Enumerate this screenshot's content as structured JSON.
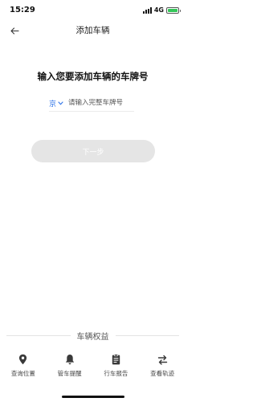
{
  "status_bar": {
    "time": "15:29",
    "network": "4G",
    "colors": {
      "battery": "#34c759"
    }
  },
  "nav": {
    "title": "添加车辆",
    "back_icon": "arrow-left-icon"
  },
  "form": {
    "heading": "输入您要添加车辆的车牌号",
    "province": "京",
    "plate_placeholder": "请输入完整车牌号",
    "plate_value": "",
    "next_label": "下一步",
    "colors": {
      "accent": "#2f74e8",
      "button_disabled": "#e5e5e5"
    }
  },
  "benefits": {
    "title": "车辆权益",
    "items": [
      {
        "label": "查询位置",
        "icon": "location-pin-icon"
      },
      {
        "label": "管车提醒",
        "icon": "bell-icon"
      },
      {
        "label": "行车报告",
        "icon": "report-clipboard-icon"
      },
      {
        "label": "查看轨迹",
        "icon": "route-arrows-icon"
      }
    ]
  }
}
